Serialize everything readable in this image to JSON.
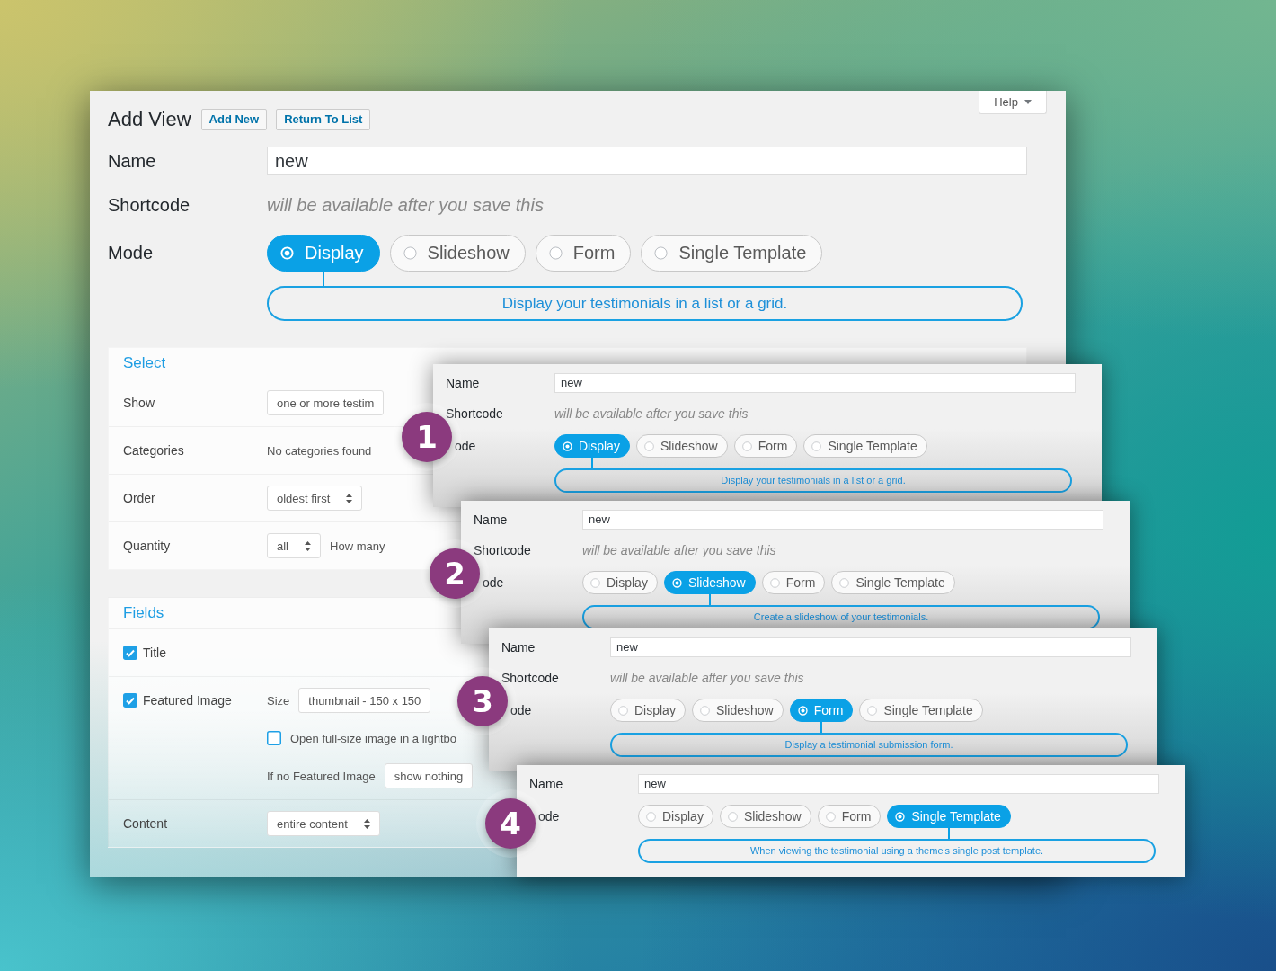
{
  "main_panel": {
    "title": "Add View",
    "actions": [
      {
        "label": "Add New"
      },
      {
        "label": "Return To List"
      }
    ],
    "help_button": {
      "label": "Help"
    },
    "form": {
      "fields": [
        {
          "kind": "input",
          "label": "Name",
          "value": "new"
        },
        {
          "kind": "note",
          "label": "Shortcode",
          "value": "will be available after you save this"
        },
        {
          "kind": "mode",
          "label": "Mode",
          "options": [
            {
              "label": "Display",
              "selected": true
            },
            {
              "label": "Slideshow",
              "selected": false
            },
            {
              "label": "Form",
              "selected": false
            },
            {
              "label": "Single Template",
              "selected": false
            }
          ],
          "description": "Display your testimonials in a list or a grid."
        }
      ]
    },
    "settings": [
      {
        "heading": "Select",
        "rows": [
          {
            "kind": "label",
            "label": "Show",
            "lines": [
              [
                {
                  "kind": "select",
                  "value": "one or more testim",
                  "arrows": false
                }
              ]
            ]
          },
          {
            "kind": "label",
            "label": "Categories",
            "lines": [
              [
                {
                  "kind": "text",
                  "value": "No categories found"
                }
              ]
            ]
          },
          {
            "kind": "label",
            "label": "Order",
            "lines": [
              [
                {
                  "kind": "select",
                  "value": "oldest first",
                  "arrows": true
                }
              ]
            ]
          },
          {
            "kind": "label",
            "label": "Quantity",
            "lines": [
              [
                {
                  "kind": "select",
                  "value": "all",
                  "arrows": true
                },
                {
                  "kind": "text",
                  "value": "How many"
                }
              ]
            ]
          }
        ]
      },
      {
        "heading": "Fields",
        "rows": [
          {
            "kind": "checkbox",
            "label": "Title",
            "checked": true
          },
          {
            "kind": "checkbox",
            "label": "Featured Image",
            "checked": true,
            "lines": [
              [
                {
                  "kind": "text",
                  "value": "Size"
                },
                {
                  "kind": "select",
                  "value": "thumbnail - 150 x 150",
                  "arrows": false
                }
              ],
              [
                {
                  "kind": "checkbox",
                  "value": "Open full-size image in a lightbo",
                  "checked": false
                }
              ],
              [
                {
                  "kind": "text",
                  "value": "If no Featured Image"
                },
                {
                  "kind": "select",
                  "value": "show nothing",
                  "arrows": false
                }
              ]
            ]
          },
          {
            "kind": "label",
            "label": "Content",
            "lines": [
              [
                {
                  "kind": "select",
                  "value": "entire content",
                  "arrows": true
                }
              ]
            ]
          }
        ]
      }
    ]
  },
  "mode_cards": [
    {
      "badge": "1",
      "form": {
        "fields": [
          {
            "kind": "input",
            "label": "Name",
            "value": "new"
          },
          {
            "kind": "note",
            "label": "Shortcode",
            "value": "will be available after you save this"
          },
          {
            "kind": "mode",
            "label": "ode",
            "options": [
              {
                "label": "Display",
                "selected": true
              },
              {
                "label": "Slideshow",
                "selected": false
              },
              {
                "label": "Form",
                "selected": false
              },
              {
                "label": "Single Template",
                "selected": false
              }
            ],
            "description": "Display your testimonials in a list or a grid."
          }
        ]
      }
    },
    {
      "badge": "2",
      "form": {
        "fields": [
          {
            "kind": "input",
            "label": "Name",
            "value": "new"
          },
          {
            "kind": "note",
            "label": "Shortcode",
            "value": "will be available after you save this"
          },
          {
            "kind": "mode",
            "label": "ode",
            "options": [
              {
                "label": "Display",
                "selected": false
              },
              {
                "label": "Slideshow",
                "selected": true
              },
              {
                "label": "Form",
                "selected": false
              },
              {
                "label": "Single Template",
                "selected": false
              }
            ],
            "description": "Create a slideshow of your testimonials."
          }
        ]
      }
    },
    {
      "badge": "3",
      "form": {
        "fields": [
          {
            "kind": "input",
            "label": "Name",
            "value": "new"
          },
          {
            "kind": "note",
            "label": "Shortcode",
            "value": "will be available after you save this"
          },
          {
            "kind": "mode",
            "label": "ode",
            "options": [
              {
                "label": "Display",
                "selected": false
              },
              {
                "label": "Slideshow",
                "selected": false
              },
              {
                "label": "Form",
                "selected": true
              },
              {
                "label": "Single Template",
                "selected": false
              }
            ],
            "description": "Display a testimonial submission form."
          }
        ]
      }
    },
    {
      "badge": "4",
      "form": {
        "fields": [
          {
            "kind": "input",
            "label": "Name",
            "value": "new"
          },
          {
            "kind": "mode",
            "label": "ode",
            "options": [
              {
                "label": "Display",
                "selected": false
              },
              {
                "label": "Slideshow",
                "selected": false
              },
              {
                "label": "Form",
                "selected": false
              },
              {
                "label": "Single Template",
                "selected": true
              }
            ],
            "description": "When viewing the testimonial using a theme's single post template."
          }
        ]
      }
    }
  ]
}
